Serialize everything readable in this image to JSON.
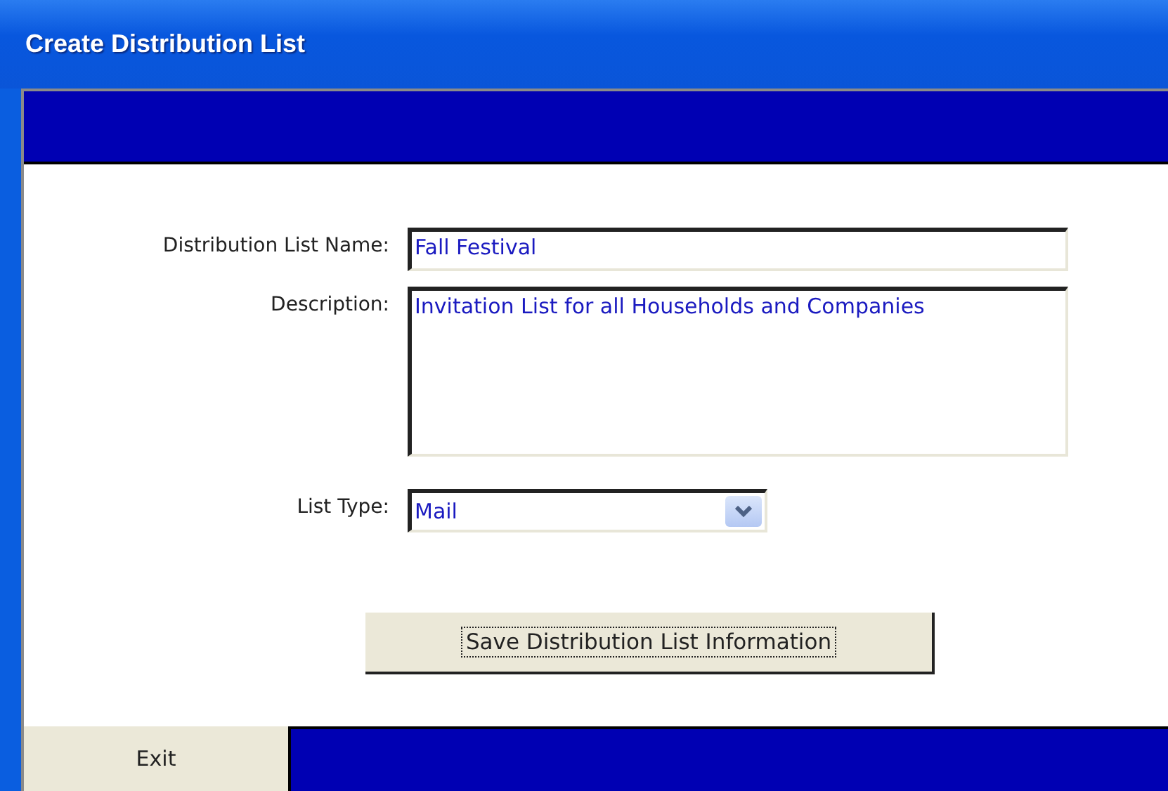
{
  "window": {
    "title": "Create Distribution List"
  },
  "form": {
    "fields": [
      {
        "kind": "text",
        "label": "Distribution List Name:",
        "value": "Fall Festival"
      },
      {
        "kind": "textarea",
        "label": "Description:",
        "value": "Invitation List for all Households and Companies"
      },
      {
        "kind": "dropdown",
        "label": "List Type:",
        "value": "Mail"
      }
    ],
    "save_button": {
      "label": "Save Distribution List Information",
      "focused": true
    }
  },
  "footer": {
    "exit_button": {
      "label": "Exit"
    }
  }
}
